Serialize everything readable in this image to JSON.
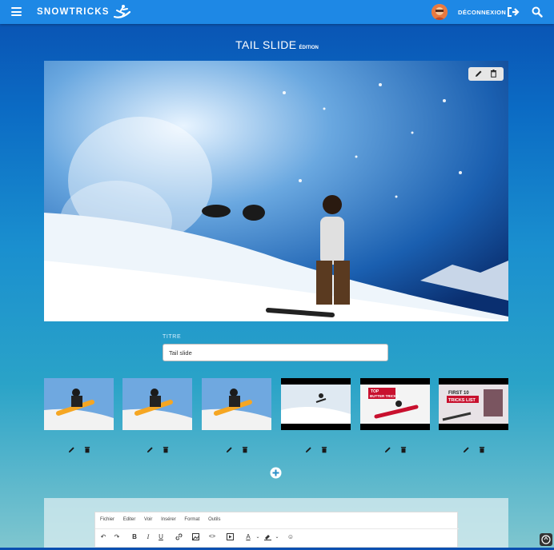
{
  "navbar": {
    "brand": "SNOWTRICKS",
    "logout_label": "DÉCONNEXION"
  },
  "page": {
    "title": "TAIL SLIDE",
    "subtitle": "ÉDITION"
  },
  "form": {
    "title_label": "TITRE",
    "title_value": "Tail slide"
  },
  "thumbnails": [
    {
      "kind": "image"
    },
    {
      "kind": "image"
    },
    {
      "kind": "image"
    },
    {
      "kind": "video"
    },
    {
      "kind": "video",
      "caption_line1": "TOP",
      "caption_line2": "BUTTER TRICKS"
    },
    {
      "kind": "video",
      "caption_line1": "FIRST 10",
      "caption_line2": "TRICKS LIST"
    }
  ],
  "editor": {
    "menu": [
      "Fichier",
      "Editer",
      "Voir",
      "Insérer",
      "Format",
      "Outils"
    ]
  },
  "colors": {
    "navbar": "#1e88e5",
    "accent": "#ffffff"
  },
  "icons": [
    "menu-icon",
    "snowboarder-logo-icon",
    "logout-icon",
    "search-icon",
    "pencil-icon",
    "trash-icon",
    "plus-circle-icon"
  ]
}
